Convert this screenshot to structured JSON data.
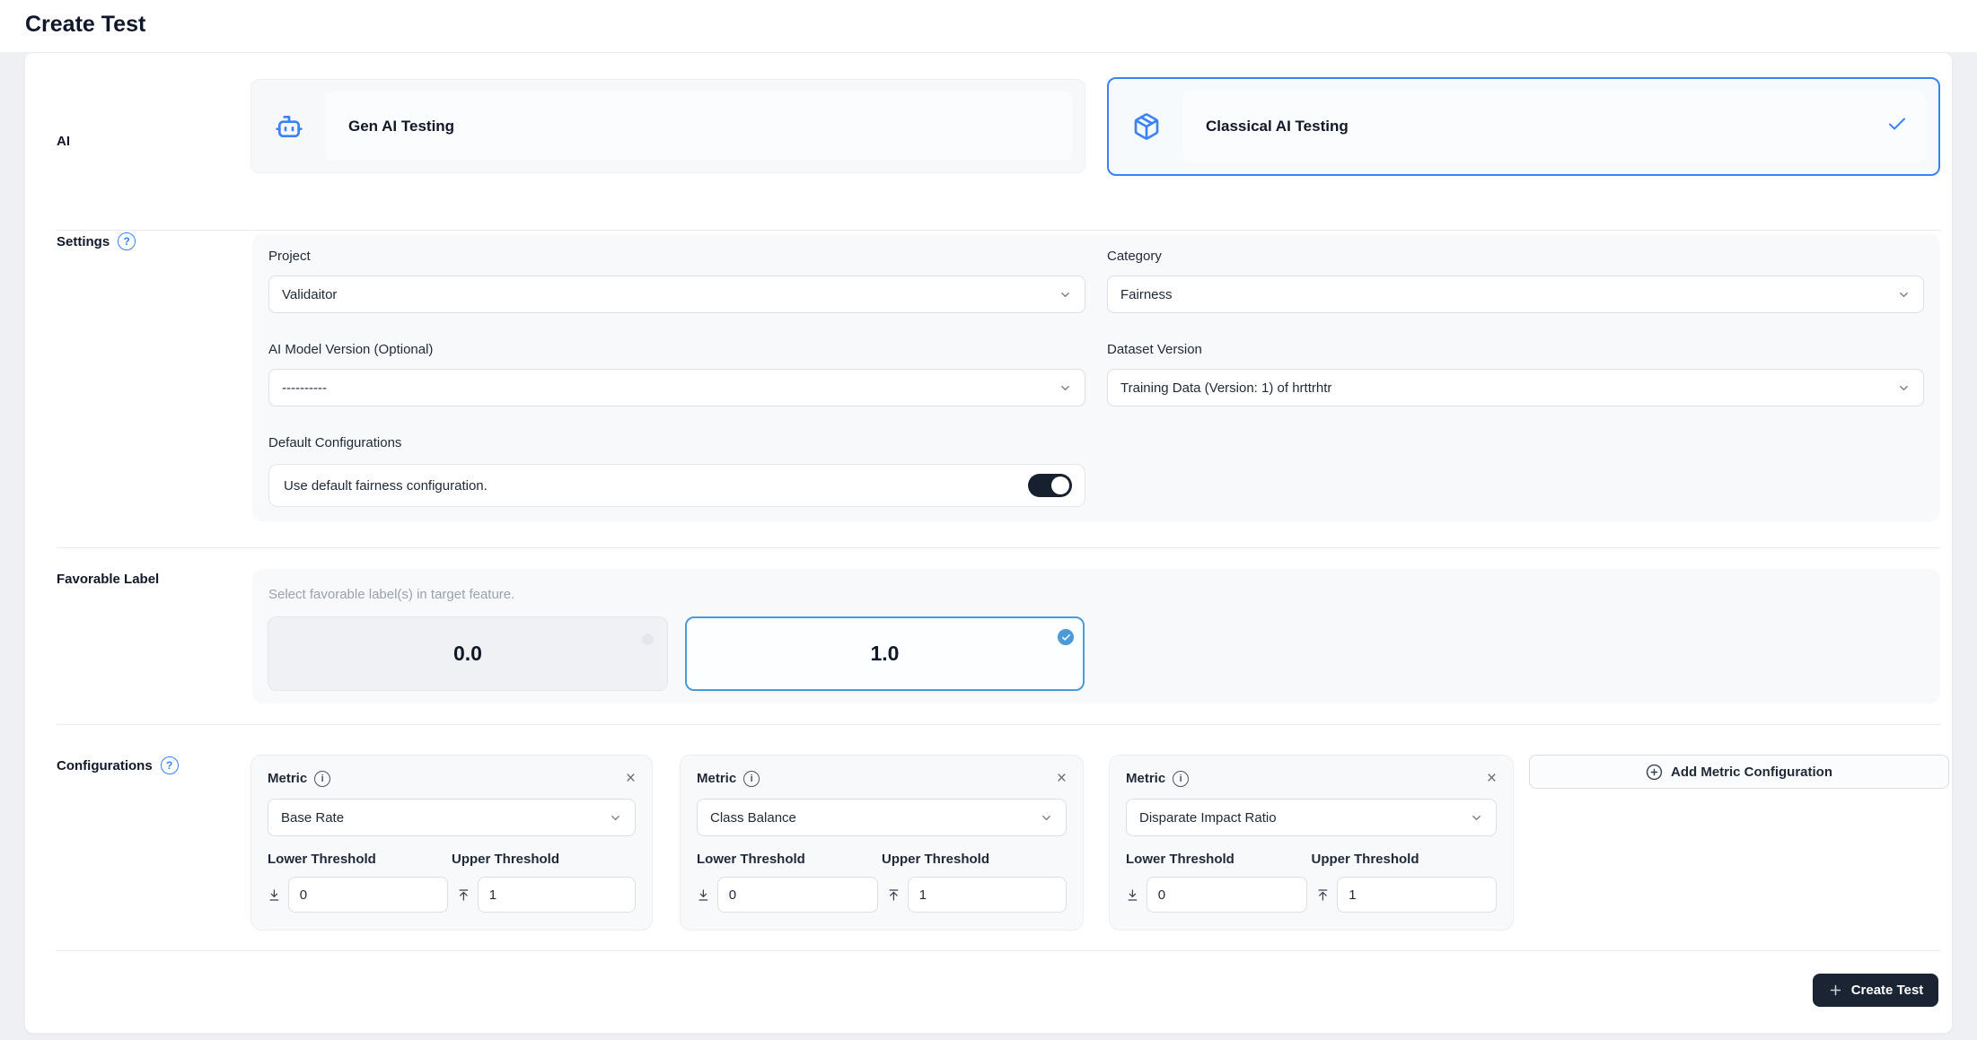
{
  "page": {
    "title": "Create Test"
  },
  "ai_section": {
    "label": "AI",
    "options": [
      {
        "label": "Gen AI Testing",
        "icon": "bot-icon",
        "selected": false
      },
      {
        "label": "Classical AI Testing",
        "icon": "package-icon",
        "selected": true
      }
    ]
  },
  "settings": {
    "label": "Settings",
    "project": {
      "label": "Project",
      "value": "Validaitor"
    },
    "category": {
      "label": "Category",
      "value": "Fairness"
    },
    "model_version": {
      "label": "AI Model Version (Optional)",
      "value": "----------"
    },
    "dataset_version": {
      "label": "Dataset Version",
      "value": "Training Data (Version: 1) of hrttrhtr"
    },
    "default_configurations": {
      "label": "Default Configurations",
      "toggle_text": "Use default fairness configuration.",
      "enabled": true
    }
  },
  "favorable": {
    "label": "Favorable Label",
    "hint": "Select favorable label(s) in target feature.",
    "options": [
      {
        "value": "0.0",
        "selected": false
      },
      {
        "value": "1.0",
        "selected": true
      }
    ]
  },
  "configurations": {
    "label": "Configurations",
    "metric_label": "Metric",
    "lower_label": "Lower Threshold",
    "upper_label": "Upper Threshold",
    "metrics": [
      {
        "metric": "Base Rate",
        "lower": "0",
        "upper": "1"
      },
      {
        "metric": "Class Balance",
        "lower": "0",
        "upper": "1"
      },
      {
        "metric": "Disparate Impact Ratio",
        "lower": "0",
        "upper": "1"
      }
    ],
    "add_button_label": "Add Metric Configuration"
  },
  "footer": {
    "create_button_label": "Create Test"
  },
  "icons": {
    "help": "?",
    "info": "i",
    "close": "×"
  },
  "colors": {
    "accent_blue": "#3b82f6",
    "selected_blue": "#4b9bd9",
    "toggle_dark": "#16202f",
    "button_dark": "#1a2433",
    "panel_bg": "#f8f9fb",
    "page_bg": "#eef0f3"
  }
}
